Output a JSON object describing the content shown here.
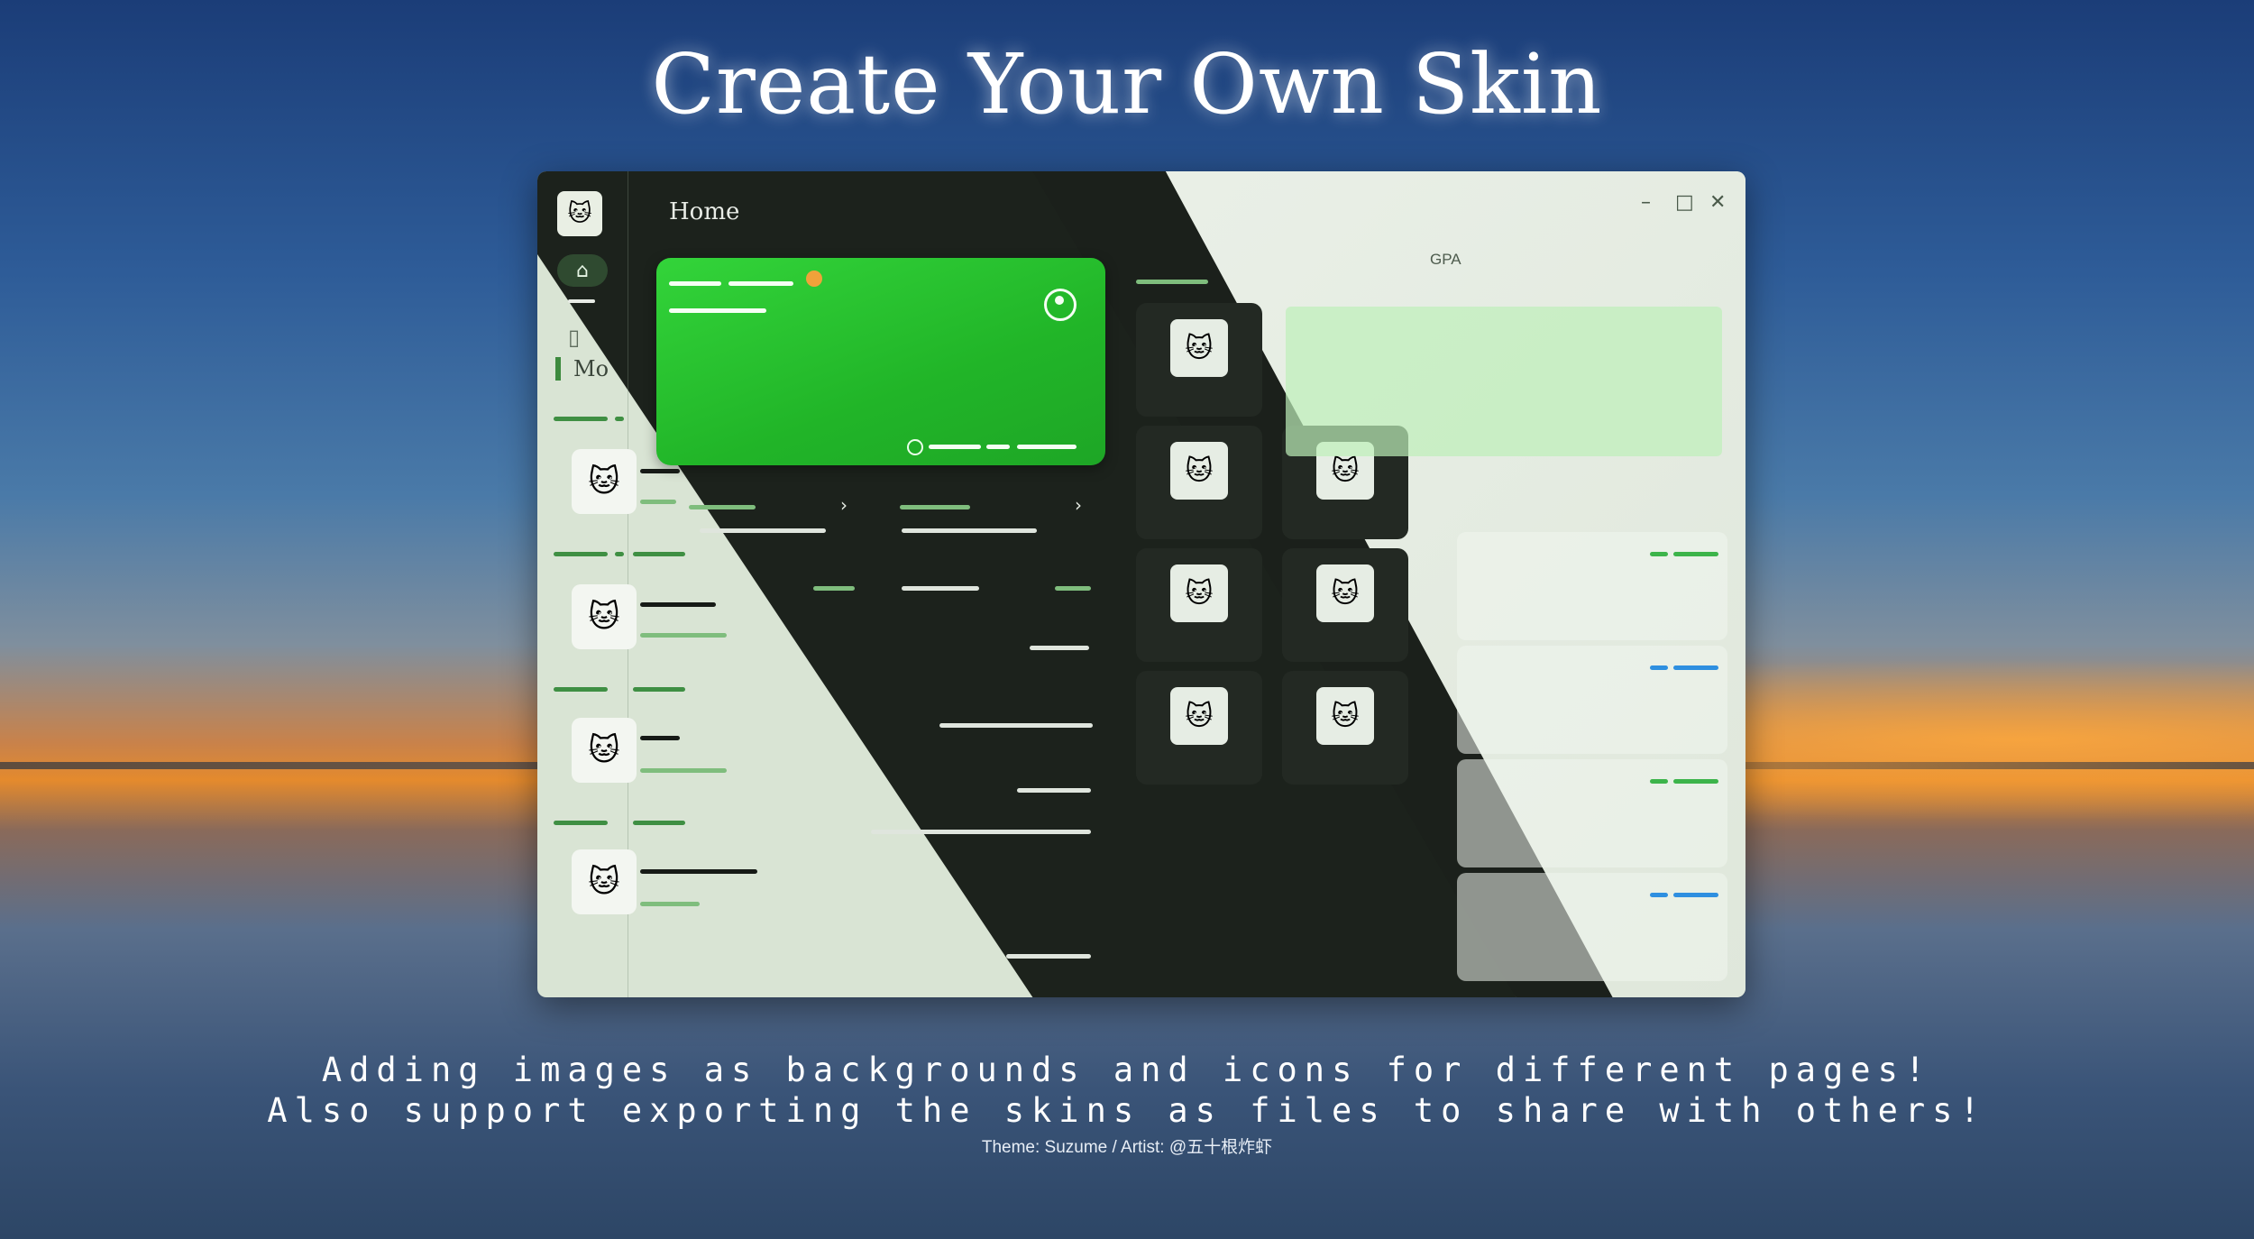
{
  "headline": "Create Your Own Skin",
  "captions": {
    "line1": "Adding images as backgrounds and icons for different pages!",
    "line2": "Also support exporting the skins as files to share with others!",
    "credit": "Theme: Suzume / Artist: @五十根炸虾"
  },
  "app": {
    "page_title": "Home",
    "sidebar_more_label": "Mo",
    "gpa_label": "GPA",
    "window_controls": {
      "minimize": "–",
      "maximize": "□",
      "close": "✕"
    },
    "chevron": "›"
  },
  "icons": {
    "home": "⌂",
    "sticker": "🐱"
  },
  "colors": {
    "accent_green": "#21b528",
    "dark_panel": "#1c221c",
    "progress_blue": "#2e8fe0"
  }
}
